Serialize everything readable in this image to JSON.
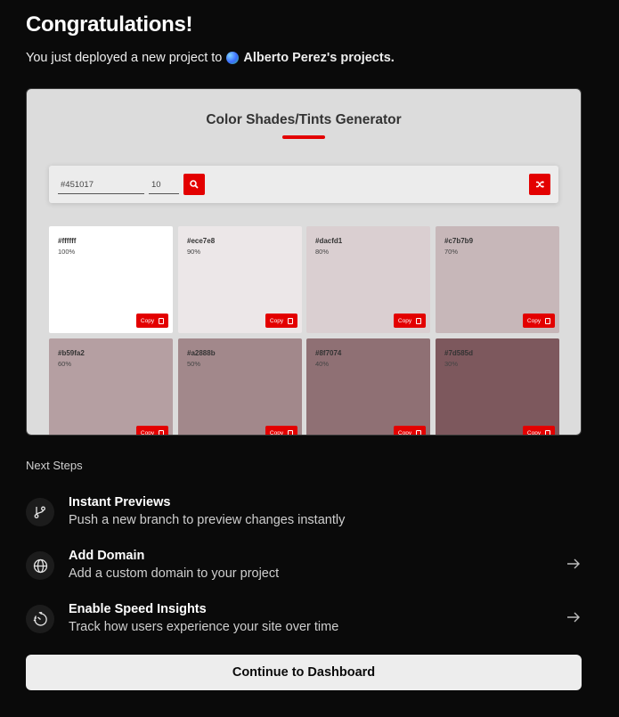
{
  "header": {
    "title": "Congratulations!",
    "subtitle_prefix": "You just deployed a new project to",
    "team_name": "Alberto Perez's projects."
  },
  "preview": {
    "app_title": "Color Shades/Tints Generator",
    "hex_input_value": "#451017",
    "steps_input_value": "10",
    "accent_color": "#e30000",
    "copy_label": "Copy",
    "swatches": [
      {
        "hex": "#ffffff",
        "pct": "100%",
        "color": "#ffffff"
      },
      {
        "hex": "#ece7e8",
        "pct": "90%",
        "color": "#ece7e8"
      },
      {
        "hex": "#dacfd1",
        "pct": "80%",
        "color": "#dacfd1"
      },
      {
        "hex": "#c7b7b9",
        "pct": "70%",
        "color": "#c7b7b9"
      },
      {
        "hex": "#b59fa2",
        "pct": "60%",
        "color": "#b59fa2"
      },
      {
        "hex": "#a2888b",
        "pct": "50%",
        "color": "#a2888b"
      },
      {
        "hex": "#8f7074",
        "pct": "40%",
        "color": "#8f7074"
      },
      {
        "hex": "#7d585d",
        "pct": "30%",
        "color": "#7d585d"
      }
    ]
  },
  "next_steps": {
    "heading": "Next Steps",
    "items": [
      {
        "title": "Instant Previews",
        "description": "Push a new branch to preview changes instantly",
        "icon": "git-branch-icon"
      },
      {
        "title": "Add Domain",
        "description": "Add a custom domain to your project",
        "icon": "globe-icon"
      },
      {
        "title": "Enable Speed Insights",
        "description": "Track how users experience your site over time",
        "icon": "speedometer-icon"
      }
    ]
  },
  "footer": {
    "continue_label": "Continue to Dashboard"
  }
}
